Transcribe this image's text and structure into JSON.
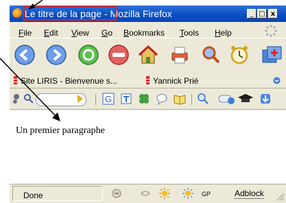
{
  "window": {
    "title": "Le titre de la page - Mozilla Firefox",
    "controls": {
      "minimize": "_",
      "maximize": "□",
      "close": "x"
    }
  },
  "menubar": {
    "items": [
      "File",
      "Edit",
      "View",
      "Go",
      "Bookmarks",
      "Tools",
      "Help"
    ]
  },
  "navigation": {
    "buttons": [
      "back-icon",
      "forward-icon",
      "reload-icon",
      "stop-icon",
      "home-icon",
      "print-icon",
      "search-icon",
      "alarm-clock-icon",
      "new-window-icon"
    ]
  },
  "bookmarks": {
    "items": [
      "Site LIRIS - Bienvenue s...",
      "Yannick Prié"
    ]
  },
  "content": {
    "paragraph": "Un premier paragraphe"
  },
  "statusbar": {
    "status": "Done",
    "gp_label": "GP",
    "adblock_label": "Adblock"
  },
  "colors": {
    "titlebar": "#0a4fc4",
    "annotation": "#e0231b",
    "chrome": "#ece9d8"
  }
}
